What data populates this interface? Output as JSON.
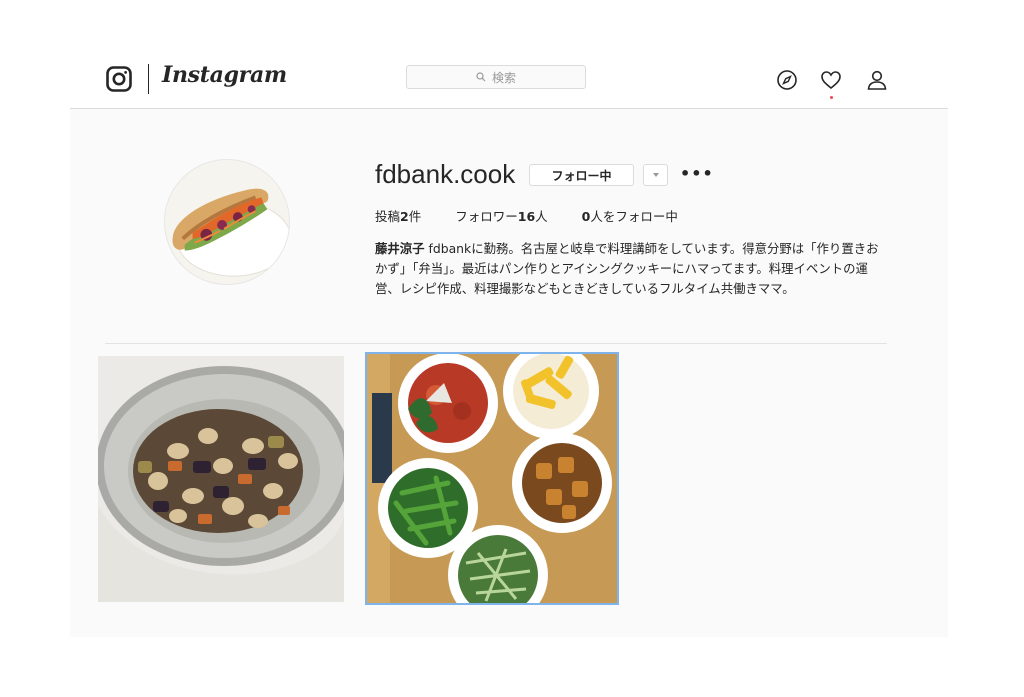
{
  "header": {
    "brand": "Instagram",
    "search_placeholder": "検索",
    "icons": [
      "instagram-logo-icon",
      "search-icon",
      "compass-icon",
      "heart-icon",
      "profile-icon"
    ]
  },
  "profile": {
    "username": "fdbank.cook",
    "follow_button": "フォロー中",
    "more_button": "•••",
    "stats": {
      "posts_prefix": "投稿",
      "posts_count": "2",
      "posts_suffix": "件",
      "followers_prefix": "フォロワー",
      "followers_count": "16",
      "followers_suffix": "人",
      "following_count": "0",
      "following_suffix": "人をフォロー中"
    },
    "bio_name": "藤井涼子",
    "bio_text": " fdbankに勤務。名古屋と岐阜で料理講師をしています。得意分野は「作り置きおかず」「弁当」。最近はパン作りとアイシングクッキーにハマってます。料理イベントの運営、レシピ作成、料理撮影などもときどきしているフルタイム共働きママ。"
  },
  "colors": {
    "accent_blue": "#7fb3ec",
    "notification": "#ed4956",
    "border": "#dbdbdb"
  }
}
